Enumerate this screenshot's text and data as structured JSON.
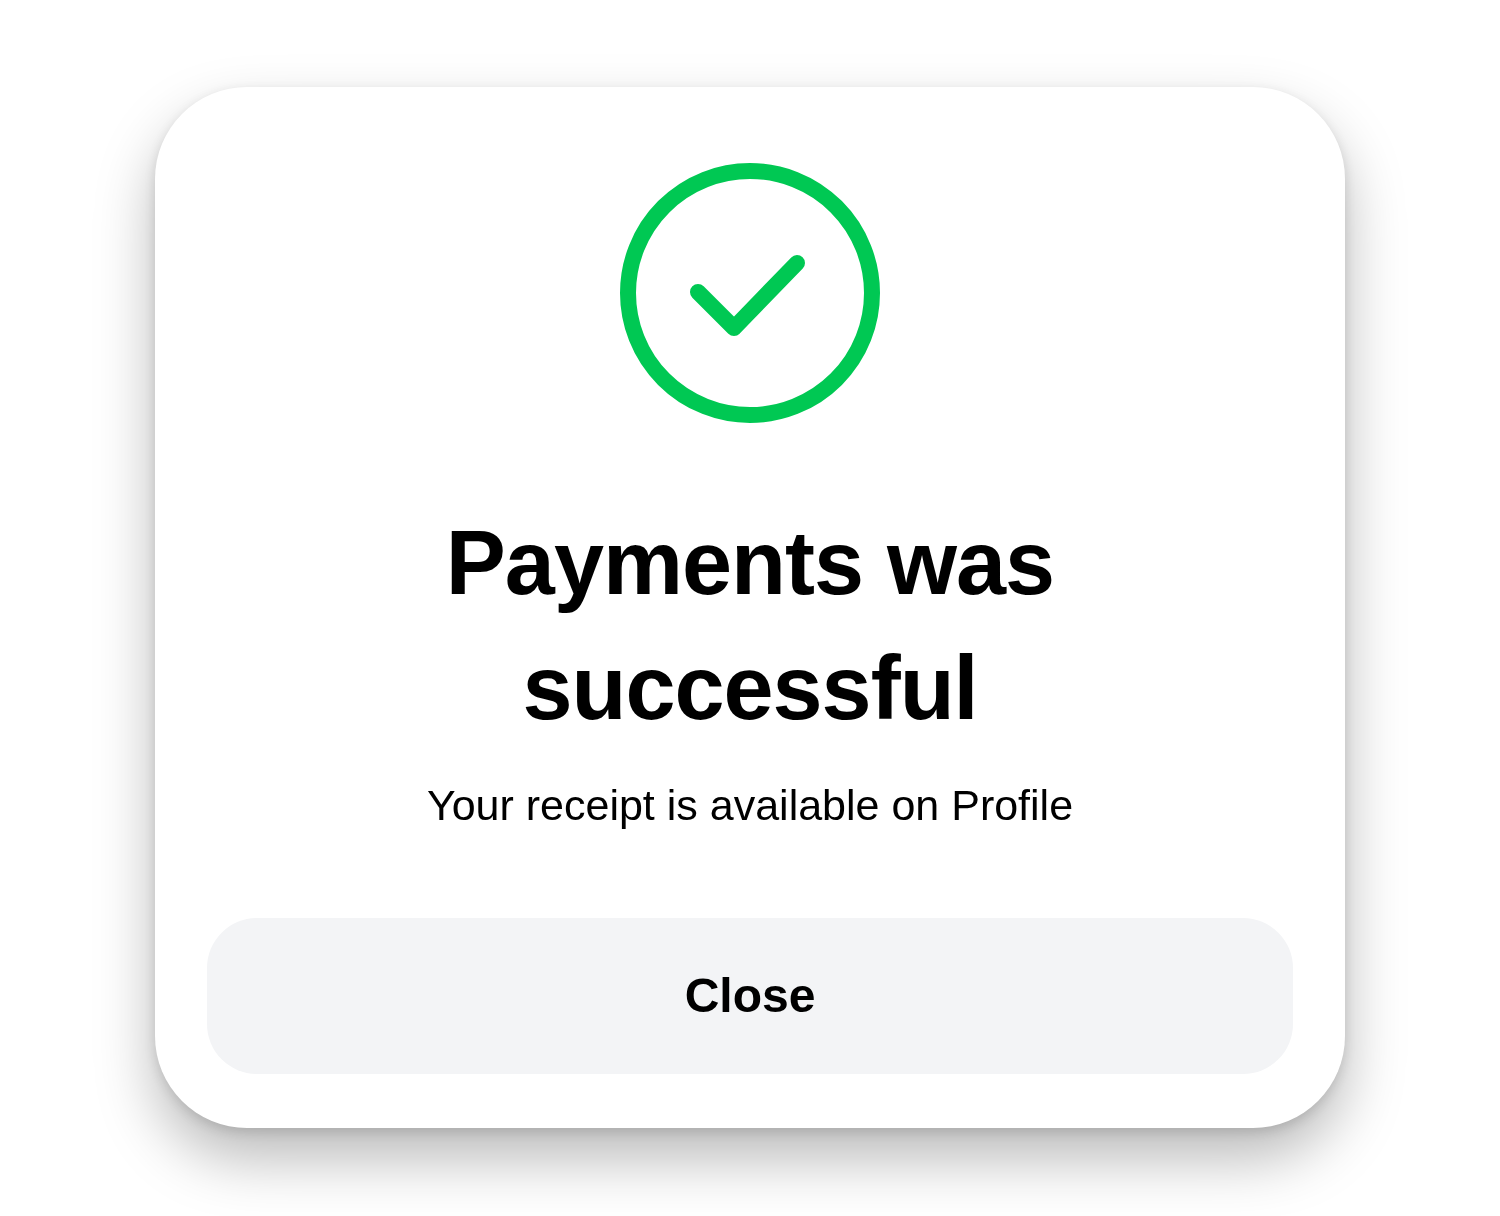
{
  "dialog": {
    "title": "Payments was successful",
    "message": "Your receipt is available on Profile",
    "buttons": [
      {
        "label": "Close"
      }
    ]
  }
}
